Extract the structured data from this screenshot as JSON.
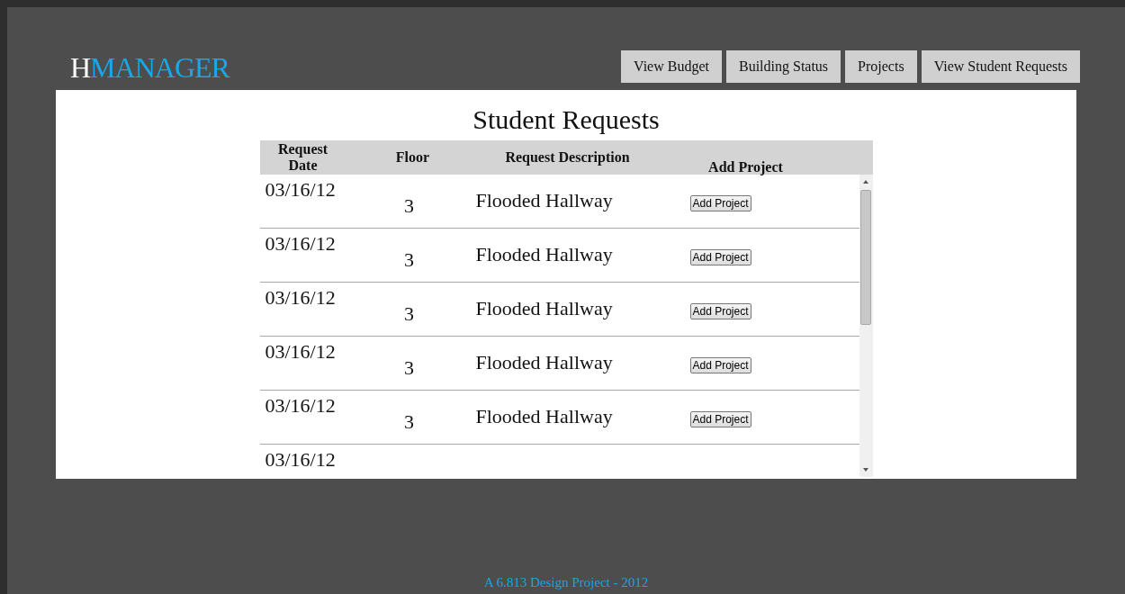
{
  "logo": {
    "initial": "H",
    "rest": "MANAGER"
  },
  "nav": [
    "View Budget",
    "Building Status",
    "Projects",
    "View Student Requests"
  ],
  "heading": "Student Requests",
  "table": {
    "columns": [
      "Request Date",
      "Floor",
      "Request Description",
      "Add Project"
    ],
    "rows": [
      {
        "date": "03/16/12",
        "floor": "3",
        "description": "Flooded Hallway",
        "action": "Add Project"
      },
      {
        "date": "03/16/12",
        "floor": "3",
        "description": "Flooded Hallway",
        "action": "Add Project"
      },
      {
        "date": "03/16/12",
        "floor": "3",
        "description": "Flooded Hallway",
        "action": "Add Project"
      },
      {
        "date": "03/16/12",
        "floor": "3",
        "description": "Flooded Hallway",
        "action": "Add Project"
      },
      {
        "date": "03/16/12",
        "floor": "3",
        "description": "Flooded Hallway",
        "action": "Add Project"
      },
      {
        "date": "03/16/12"
      }
    ]
  },
  "footer": "A 6.813 Design Project - 2012"
}
